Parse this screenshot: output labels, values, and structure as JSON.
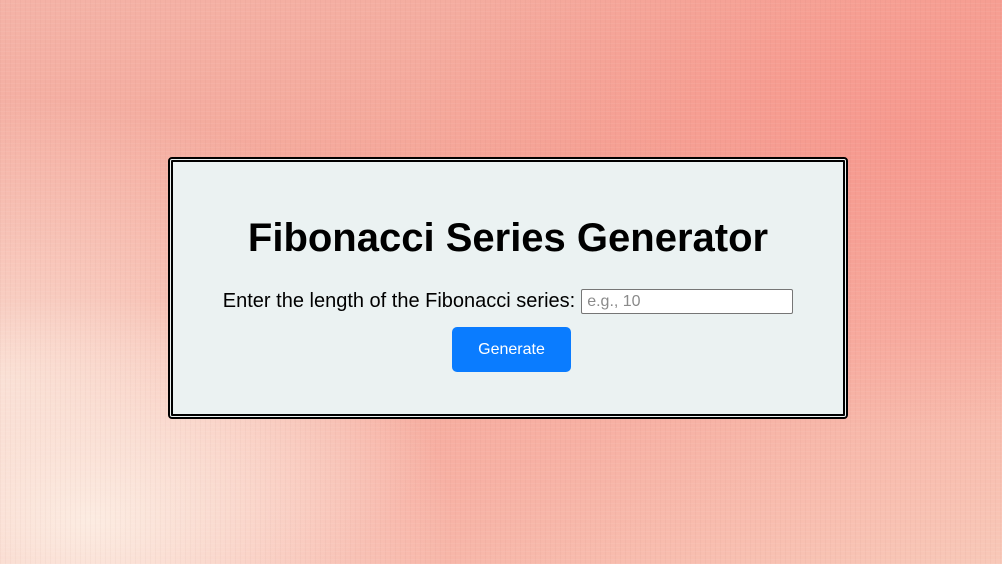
{
  "app": {
    "title": "Fibonacci Series Generator"
  },
  "form": {
    "label": "Enter the length of the Fibonacci series:",
    "input_value": "",
    "input_placeholder": "e.g., 10",
    "generate_label": "Generate"
  },
  "colors": {
    "button": "#0a7cff",
    "card_background": "#ebf2f2",
    "page_background": "#f5a597"
  }
}
